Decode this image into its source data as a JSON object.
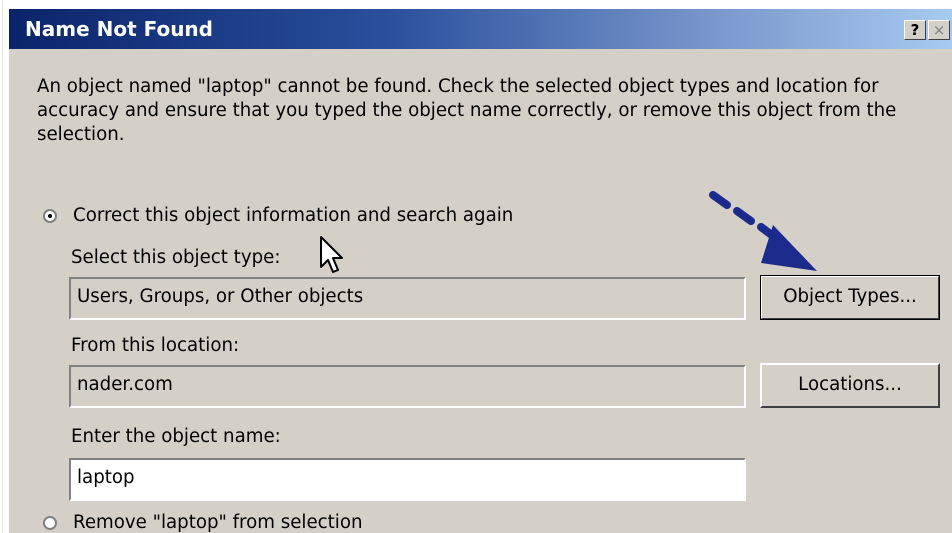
{
  "dialog": {
    "title": "Name Not Found",
    "help_glyph": "?",
    "close_glyph": "×",
    "message": "An object named \"laptop\" cannot be found. Check the selected object types and location for accuracy and ensure that you typed the object name correctly, or remove this object from the selection."
  },
  "options": {
    "correct_label": "Correct this object information and search again",
    "remove_label": "Remove \"laptop\" from selection",
    "selected": "correct"
  },
  "form": {
    "object_type_label": "Select this object type:",
    "object_type_value": "Users, Groups, or Other objects",
    "object_types_button": "Object Types...",
    "location_label": "From this location:",
    "location_value": "nader.com",
    "locations_button": "Locations...",
    "name_label": "Enter the object name:",
    "name_value": "laptop"
  },
  "colors": {
    "title_gradient_start": "#0a246a",
    "title_gradient_end": "#a6caf0",
    "dialog_background": "#d4d0c8",
    "annotation_arrow": "#1c2a8c"
  },
  "icons": {
    "annotation": "dashed-arrow-icon",
    "pointer": "mouse-cursor-icon"
  }
}
